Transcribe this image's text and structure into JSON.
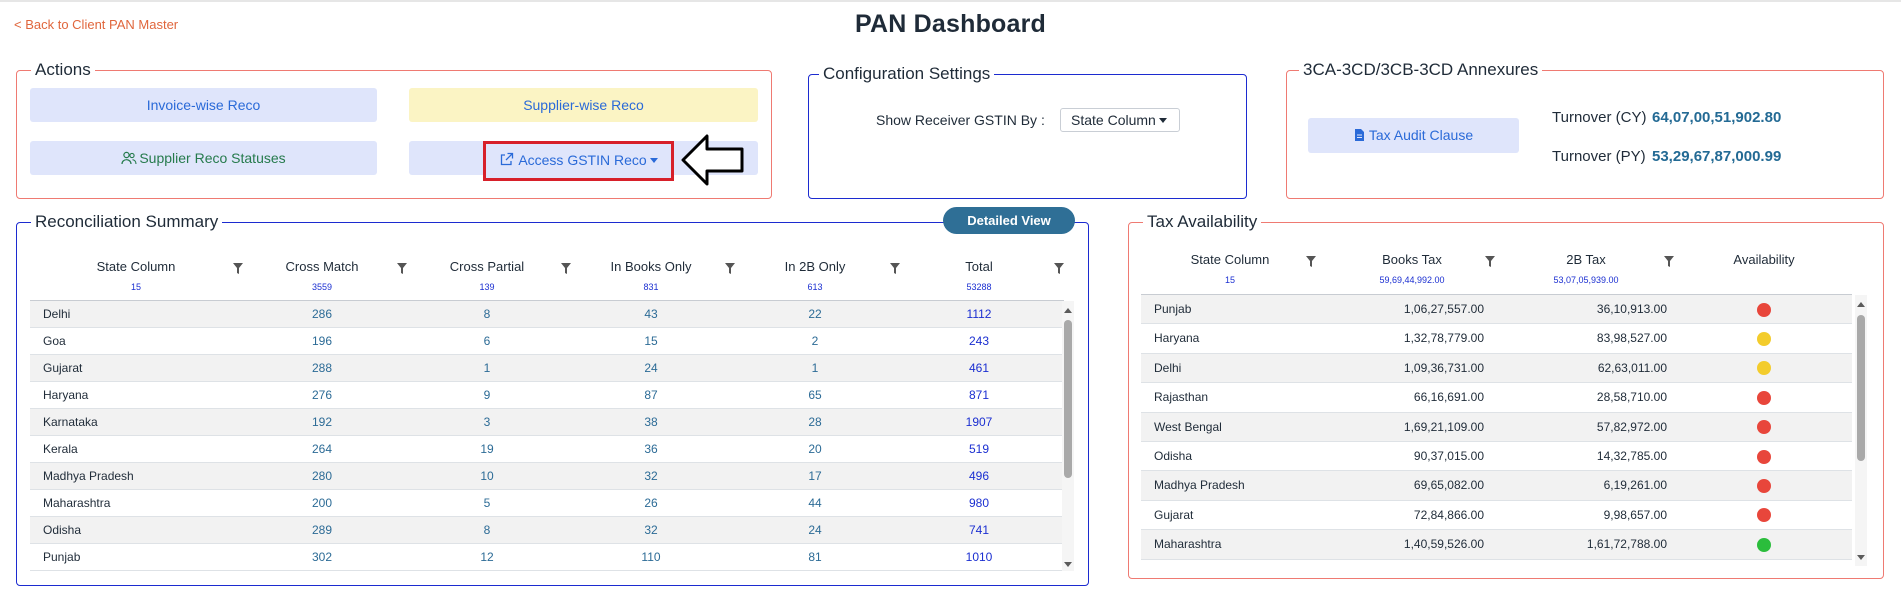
{
  "header": {
    "back_link": "< Back to Client PAN Master",
    "title": "PAN Dashboard"
  },
  "actions": {
    "legend": "Actions",
    "invoice_wise": "Invoice-wise Reco",
    "supplier_wise": "Supplier-wise Reco",
    "supplier_statuses": "Supplier Reco Statuses",
    "access_gstin": "Access GSTIN Reco"
  },
  "config": {
    "legend": "Configuration Settings",
    "label": "Show Receiver GSTIN By :",
    "selected": "State Column"
  },
  "annexures": {
    "legend": "3CA-3CD/3CB-3CD Annexures",
    "tax_audit_button": "Tax Audit Clause",
    "turnover_cy_label": "Turnover (CY)",
    "turnover_cy_value": "64,07,00,51,902.80",
    "turnover_py_label": "Turnover (PY)",
    "turnover_py_value": "53,29,67,87,000.99"
  },
  "reco": {
    "legend": "Reconciliation Summary",
    "detailed_view": "Detailed View",
    "columns": [
      "State Column",
      "Cross Match",
      "Cross Partial",
      "In Books Only",
      "In 2B Only",
      "Total"
    ],
    "counts": [
      "15",
      "3559",
      "139",
      "831",
      "613",
      "53288"
    ],
    "rows": [
      [
        "Delhi",
        "286",
        "8",
        "43",
        "22",
        "1112"
      ],
      [
        "Goa",
        "196",
        "6",
        "15",
        "2",
        "243"
      ],
      [
        "Gujarat",
        "288",
        "1",
        "24",
        "1",
        "461"
      ],
      [
        "Haryana",
        "276",
        "9",
        "87",
        "65",
        "871"
      ],
      [
        "Karnataka",
        "192",
        "3",
        "38",
        "28",
        "1907"
      ],
      [
        "Kerala",
        "264",
        "19",
        "36",
        "20",
        "519"
      ],
      [
        "Madhya Pradesh",
        "280",
        "10",
        "32",
        "17",
        "496"
      ],
      [
        "Maharashtra",
        "200",
        "5",
        "26",
        "44",
        "980"
      ],
      [
        "Odisha",
        "289",
        "8",
        "32",
        "24",
        "741"
      ],
      [
        "Punjab",
        "302",
        "12",
        "110",
        "81",
        "1010"
      ]
    ]
  },
  "tax": {
    "legend": "Tax Availability",
    "columns": [
      "State Column",
      "Books Tax",
      "2B Tax",
      "Availability"
    ],
    "counts": [
      "15",
      "59,69,44,992.00",
      "53,07,05,939.00",
      ""
    ],
    "rows": [
      [
        "Punjab",
        "1,06,27,557.00",
        "36,10,913.00",
        "red"
      ],
      [
        "Haryana",
        "1,32,78,779.00",
        "83,98,527.00",
        "yellow"
      ],
      [
        "Delhi",
        "1,09,36,731.00",
        "62,63,011.00",
        "yellow"
      ],
      [
        "Rajasthan",
        "66,16,691.00",
        "28,58,710.00",
        "red"
      ],
      [
        "West Bengal",
        "1,69,21,109.00",
        "57,82,972.00",
        "red"
      ],
      [
        "Odisha",
        "90,37,015.00",
        "14,32,785.00",
        "red"
      ],
      [
        "Madhya Pradesh",
        "69,65,082.00",
        "6,19,261.00",
        "red"
      ],
      [
        "Gujarat",
        "72,84,866.00",
        "9,98,657.00",
        "red"
      ],
      [
        "Maharashtra",
        "1,40,59,526.00",
        "1,61,72,788.00",
        "green"
      ]
    ],
    "status_colors": {
      "red": "#e8463b",
      "yellow": "#f3cc2c",
      "green": "#2bbd3c"
    }
  }
}
